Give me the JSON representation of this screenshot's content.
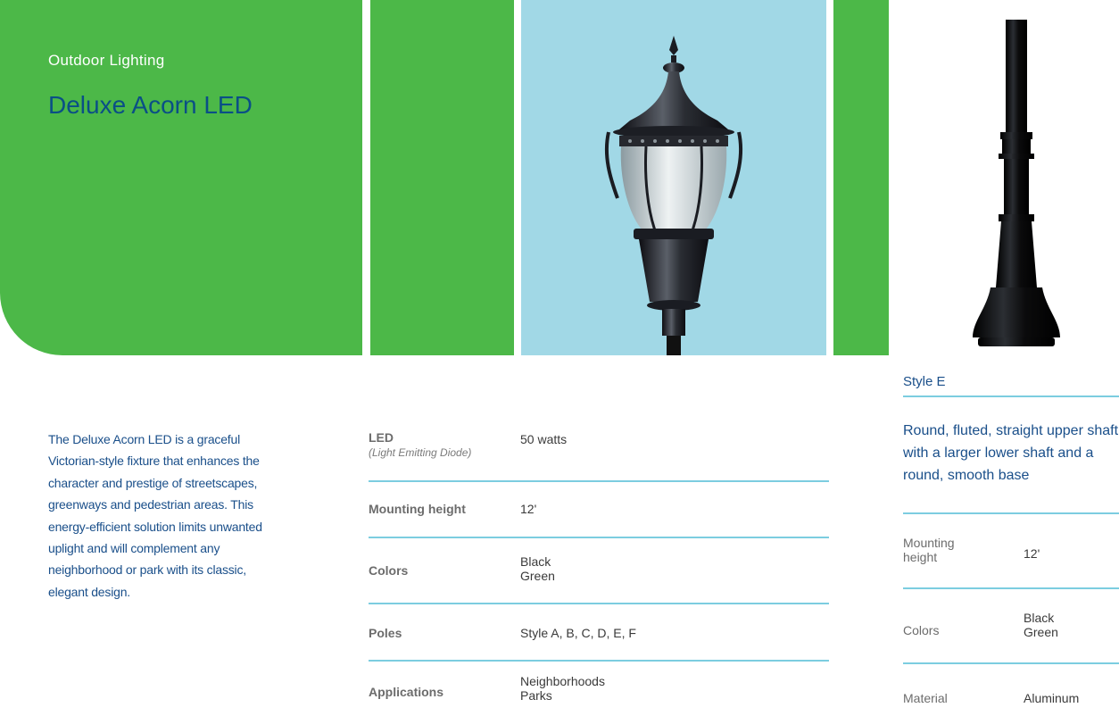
{
  "header": {
    "category": "Outdoor Lighting",
    "title": "Deluxe Acorn LED"
  },
  "colors": {
    "brand_green": "#4cb848",
    "sky_blue": "#a1d8e6",
    "title_blue": "#0a4f86",
    "rule_cyan": "#7ccde0"
  },
  "description": "The Deluxe Acorn LED is a graceful Victorian-style fixture that enhances the character and prestige of streetscapes, greenways and pedestrian areas. This energy-efficient solution limits unwanted uplight and will complement any neighborhood or park with its classic, elegant design.",
  "specs": {
    "led": {
      "label": "LED",
      "sublabel": "(Light Emitting Diode)",
      "value": "50 watts"
    },
    "mounting": {
      "label": "Mounting height",
      "value": "12'"
    },
    "colors": {
      "label": "Colors",
      "values": [
        "Black",
        "Green"
      ]
    },
    "poles": {
      "label": "Poles",
      "value": "Style A, B, C, D, E, F"
    },
    "applications": {
      "label": "Applications",
      "values": [
        "Neighborhoods",
        "Parks"
      ]
    }
  },
  "pole_style": {
    "name": "Style E",
    "description": "Round, fluted, straight upper shaft with a larger lower shaft and a round, smooth base",
    "mounting": {
      "label": "Mounting height",
      "value": "12'"
    },
    "colors": {
      "label": "Colors",
      "values": [
        "Black",
        "Green"
      ]
    },
    "material": {
      "label": "Material",
      "value": "Aluminum"
    }
  },
  "images": {
    "fixture": "acorn-lamp-fixture-photo",
    "pole": "style-e-pole-photo"
  }
}
